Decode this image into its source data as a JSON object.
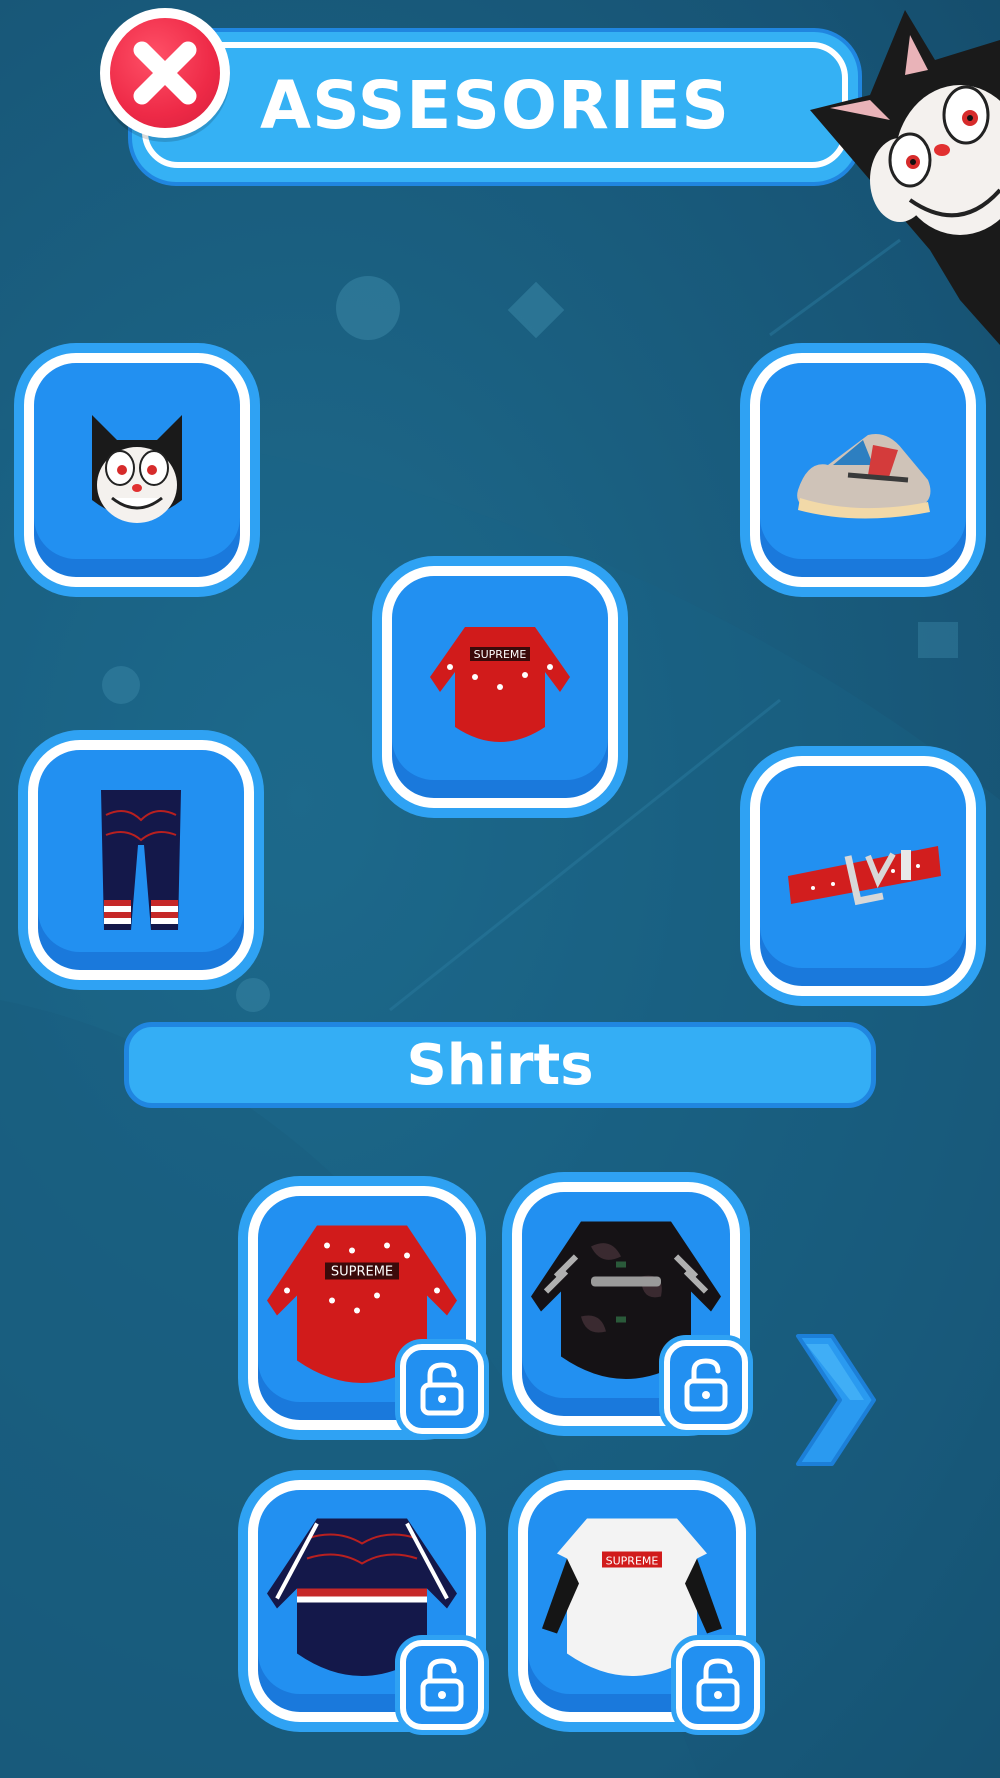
{
  "header": {
    "title": "ASSESORIES",
    "close_icon": "close-x-icon"
  },
  "mascot": {
    "icon": "black-cat-mascot"
  },
  "equipped_slots": [
    {
      "name": "head",
      "icon": "cat-mask-icon"
    },
    {
      "name": "shoes",
      "icon": "sneaker-icon"
    },
    {
      "name": "shirt",
      "icon": "red-supreme-shirt-icon",
      "print": "SUPREME"
    },
    {
      "name": "pants",
      "icon": "striped-pants-icon"
    },
    {
      "name": "belt",
      "icon": "red-belt-icon"
    }
  ],
  "section": {
    "title": "Shirts"
  },
  "shirts": [
    {
      "icon": "red-supreme-shirt-icon",
      "print": "SUPREME",
      "lock": "unlock-icon"
    },
    {
      "icon": "black-camo-shirt-icon",
      "lock": "unlock-icon"
    },
    {
      "icon": "navy-striped-shirt-icon",
      "lock": "unlock-icon"
    },
    {
      "icon": "white-supreme-shirt-icon",
      "print": "SUPREME",
      "lock": "unlock-icon"
    }
  ],
  "navigation": {
    "next_icon": "chevron-right-icon"
  },
  "colors": {
    "background": "#1a5f80",
    "tile": "#2290f1",
    "tile_border": "#ffffff",
    "title_bar": "#35b1f4",
    "close_button": "#ee2a47"
  }
}
